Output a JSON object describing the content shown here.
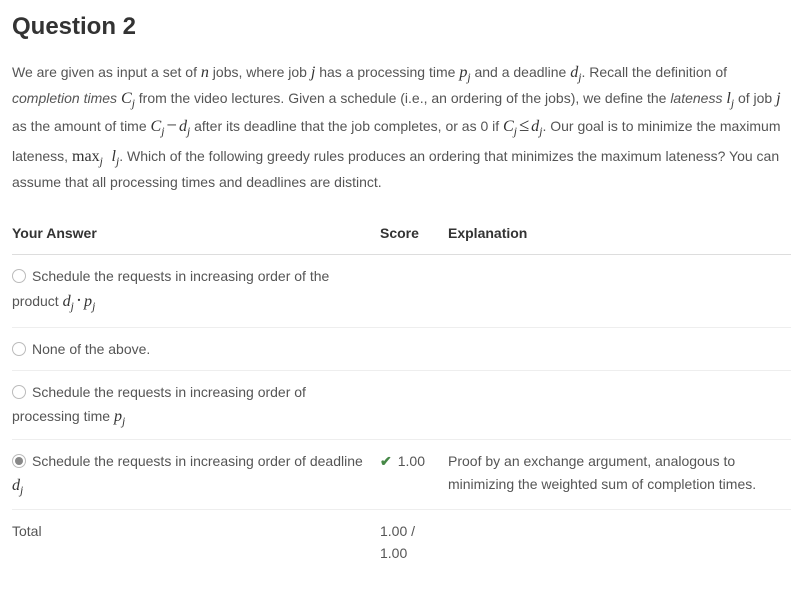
{
  "title": "Question 2",
  "prompt": {
    "p1_a": "We are given as input a set of ",
    "p1_b": " jobs, where job ",
    "p1_c": " has a processing time ",
    "p1_d": " and a deadline ",
    "p1_e": ". Recall the definition of ",
    "ital1": "completion times",
    "p2_a": " from the video lectures. Given a schedule (i.e., an ordering of the jobs), we define the ",
    "ital2": "lateness",
    "p2_b": " of job ",
    "p2_c": " as the amount of time ",
    "p2_d": " after its deadline that the job completes, or as 0 if ",
    "p2_e": ". Our goal is to minimize the maximum lateness, ",
    "p2_f": ". Which of the following greedy rules produces an ordering that minimizes the maximum lateness? You can assume that all processing times and deadlines are distinct."
  },
  "math": {
    "n": "n",
    "j": "j",
    "pj_p": "p",
    "pj_j": "j",
    "dj_d": "d",
    "dj_j": "j",
    "Cj_C": "C",
    "Cj_j": "j",
    "lj_l": "l",
    "lj_j": "j",
    "minus": "−",
    "leq": "≤",
    "dot": "·",
    "max": "max",
    "space": " "
  },
  "headers": {
    "answer": "Your Answer",
    "score": "Score",
    "explanation": "Explanation"
  },
  "options": [
    {
      "pre": "Schedule the requests in increasing order of the product ",
      "mathkey": "dp",
      "selected": false,
      "score": "",
      "explanation": ""
    },
    {
      "pre": "None of the above.",
      "mathkey": "",
      "selected": false,
      "score": "",
      "explanation": ""
    },
    {
      "pre": "Schedule the requests in increasing order of processing time ",
      "mathkey": "p",
      "selected": false,
      "score": "",
      "explanation": ""
    },
    {
      "pre": "Schedule the requests in increasing order of deadline ",
      "mathkey": "d",
      "selected": true,
      "score": "1.00",
      "explanation": "Proof by an exchange argument, analogous to minimizing the weighted sum of completion times."
    }
  ],
  "total": {
    "label": "Total",
    "score": "1.00 / 1.00"
  }
}
